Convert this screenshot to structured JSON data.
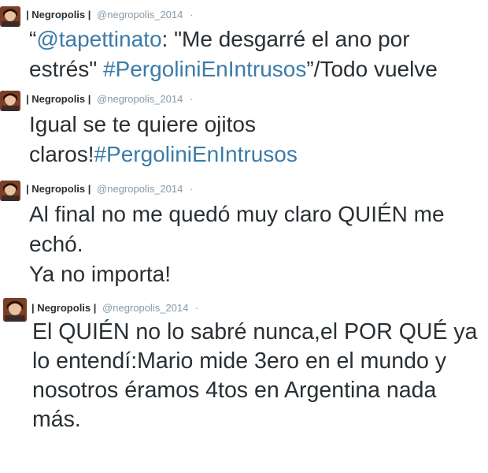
{
  "colors": {
    "text": "#292f33",
    "meta": "#8899a6",
    "link": "#3b7ba8"
  },
  "tweets": [
    {
      "name": "| Negropolis |",
      "handle": "@negropolis_2014",
      "dot": "·",
      "line1": {
        "pre": "“",
        "mention": "@tapettinato",
        "post": ": \"Me desgarré el ano por"
      },
      "line2": {
        "pre": "estrés\" ",
        "hashtag": "#PergoliniEnIntrusos",
        "post": "”/Todo vuelve"
      }
    },
    {
      "name": "| Negropolis |",
      "handle": "@negropolis_2014",
      "dot": "·",
      "line1": "Igual se te quiere ojitos",
      "line2": {
        "pre": "claros!",
        "hashtag": "#PergoliniEnIntrusos"
      }
    },
    {
      "name": "| Negropolis |",
      "handle": "@negropolis_2014",
      "dot": "·",
      "line1": "Al final no me quedó muy claro QUIÉN me",
      "line2": "echó.",
      "line3": "Ya no importa!"
    },
    {
      "name": "| Negropolis |",
      "handle": "@negropolis_2014",
      "dot": "·",
      "line1": "El QUIÉN no lo sabré nunca,el POR QUÉ ya",
      "line2": "lo entendí:Mario mide 3ero en el mundo y",
      "line3": "nosotros éramos 4tos en Argentina nada",
      "line4": "más."
    }
  ]
}
